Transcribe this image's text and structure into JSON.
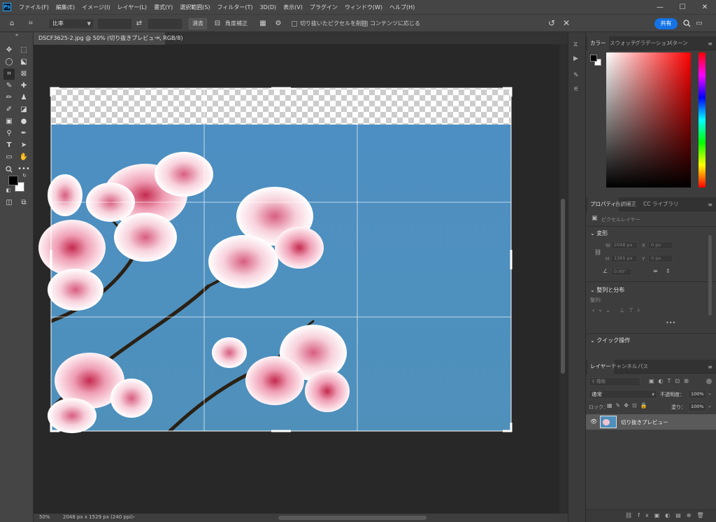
{
  "app": {
    "logo_text": "Ps"
  },
  "menu": [
    "ファイル(F)",
    "編集(E)",
    "イメージ(I)",
    "レイヤー(L)",
    "書式(Y)",
    "選択範囲(S)",
    "フィルター(T)",
    "3D(D)",
    "表示(V)",
    "プラグイン",
    "ウィンドウ(W)",
    "ヘルプ(H)"
  ],
  "window_controls": {
    "minimize": "—",
    "maximize": "☐",
    "close": "✕"
  },
  "options": {
    "ratio_label": "比率",
    "clear_label": "消去",
    "straighten_label": "角度補正",
    "delete_cropped_label": "切り抜いたピクセルを削除",
    "content_aware_label": "コンテンツに応じる",
    "share_label": "共有"
  },
  "document": {
    "tab_title": "DSCF3625-2.jpg @ 50% (切り抜きプレビュー, RGB/8)",
    "zoom": "50%",
    "info": "2048 px x 1529 px (240 ppi)"
  },
  "panels": {
    "color_tabs": [
      "カラー",
      "スウォッチ",
      "グラデーション",
      "パターン"
    ],
    "props_tabs": [
      "プロパティ",
      "色調補正",
      "CC ライブラリ"
    ],
    "pixel_layer": "ピクセルレイヤー",
    "transform": "変形",
    "w_label": "W",
    "w_value": "2048 px",
    "h_label": "H",
    "h_value": "1365 px",
    "x_label": "X",
    "x_value": "0 px",
    "y_label": "Y",
    "y_value": "0 px",
    "angle_value": "0.00°",
    "align": "整列と分布",
    "align_sub": "整列:",
    "quick": "クイック操作",
    "layers_tabs": [
      "レイヤー",
      "チャンネル",
      "パス"
    ],
    "search_placeholder": "種類",
    "blend_mode": "通常",
    "opacity_label": "不透明度：",
    "opacity_value": "100%",
    "lock_label": "ロック：",
    "fill_label": "塗り：",
    "fill_value": "100%",
    "layer_name": "切り抜きプレビュー"
  },
  "colors": {
    "accent": "#1473e6",
    "sky": "#4e8fbd",
    "blossom": "#f1c3cf"
  }
}
